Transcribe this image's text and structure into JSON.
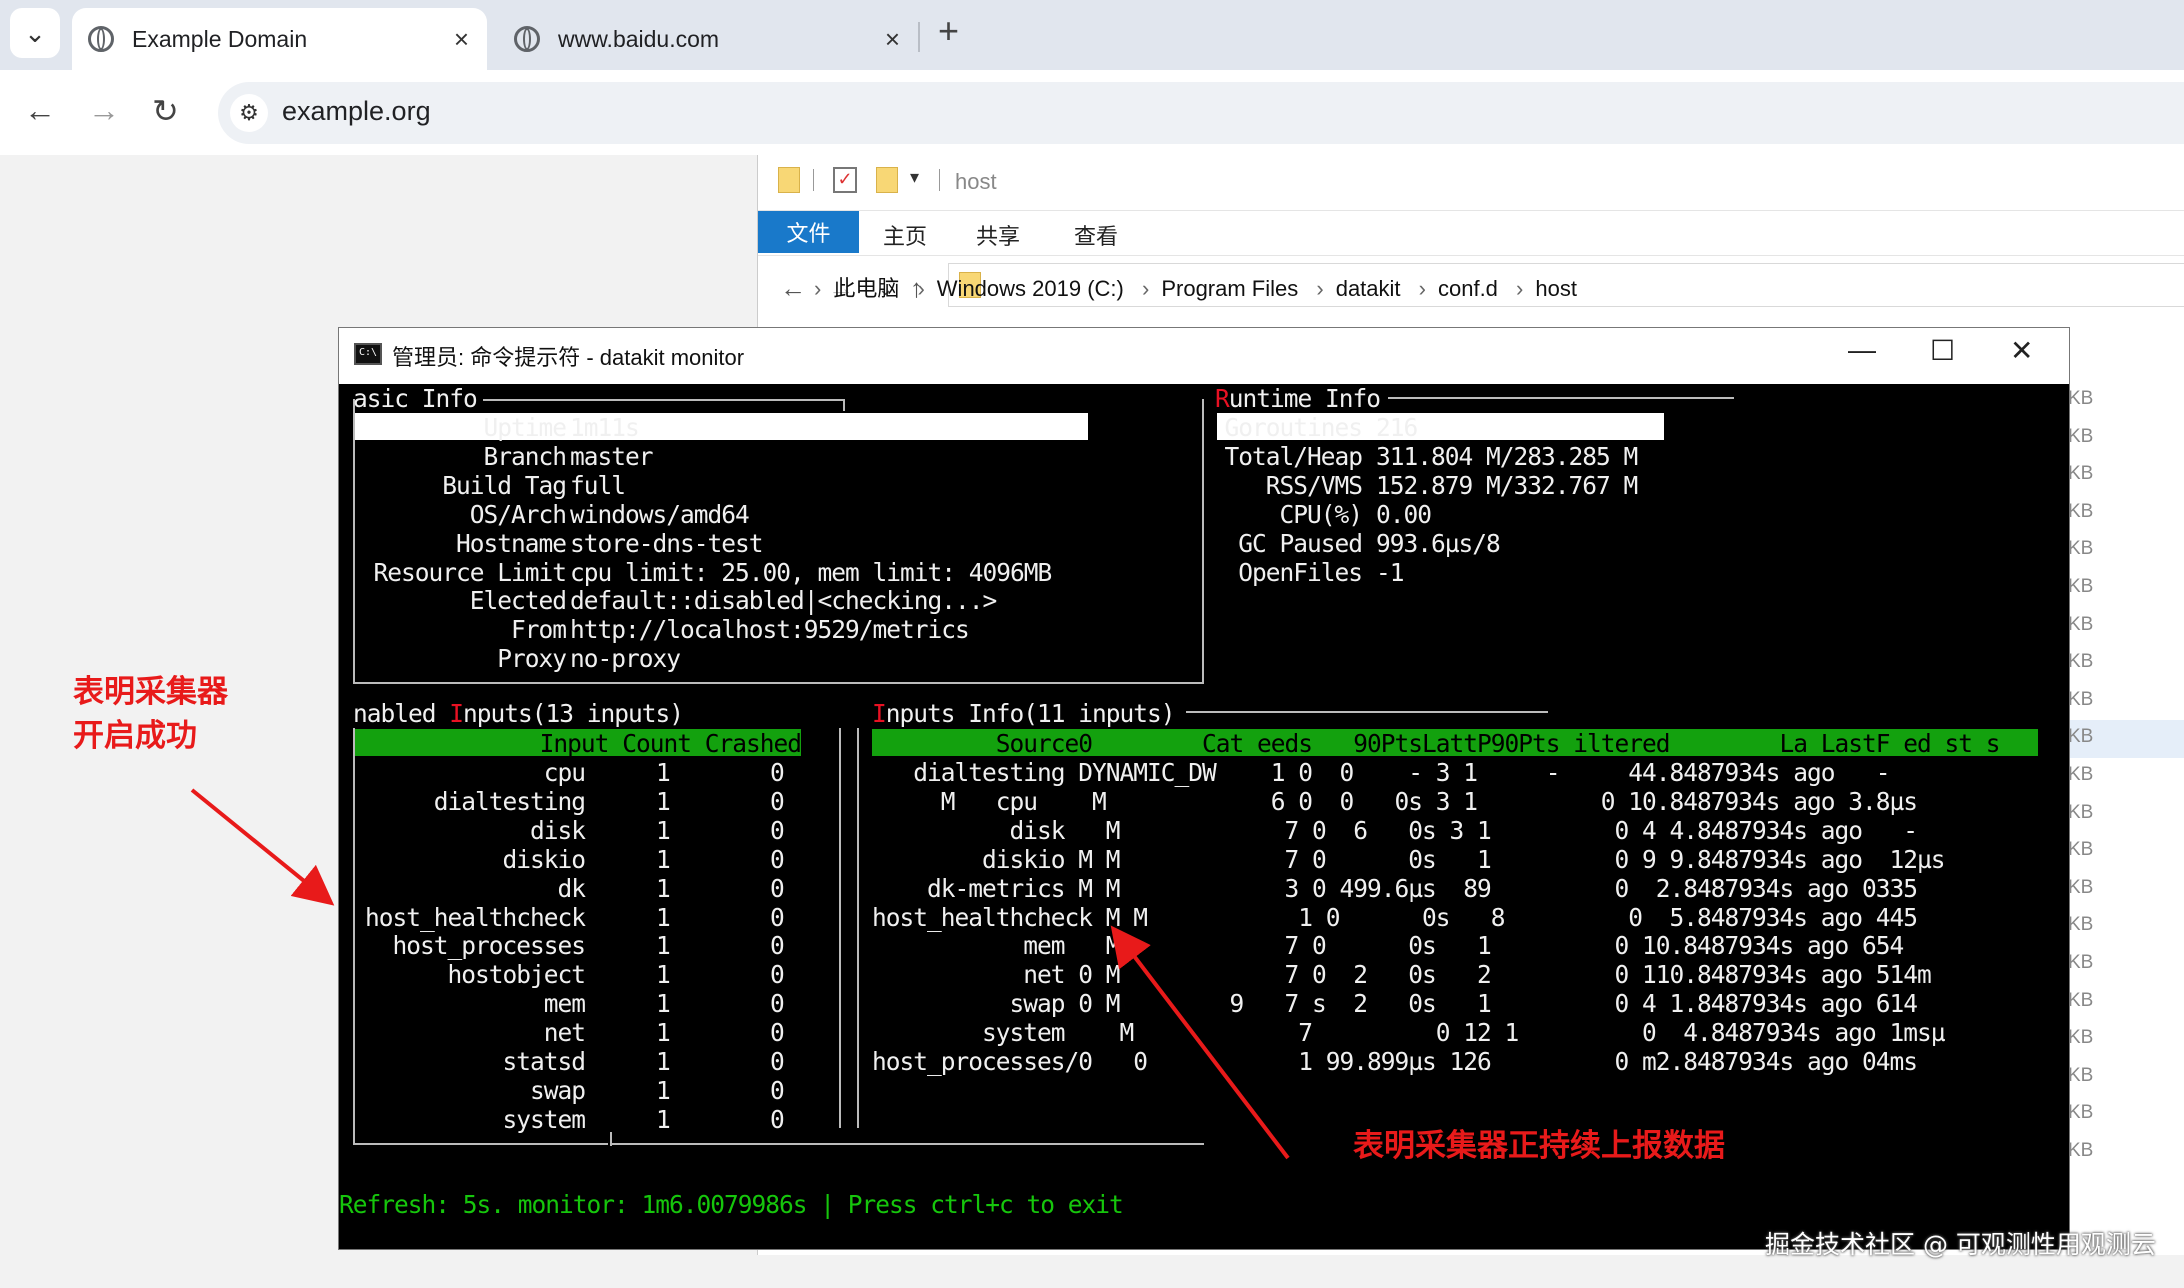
{
  "browser": {
    "tabs": [
      {
        "title": "Example Domain",
        "close": "×"
      },
      {
        "title": "www.baidu.com",
        "close": "×"
      }
    ],
    "new_tab": "+",
    "menu_icon": "⌄",
    "address": "example.org",
    "nav": {
      "back": "←",
      "forward": "→",
      "reload": "↻"
    }
  },
  "explorer": {
    "title": "host",
    "ribbon": {
      "file": "文件",
      "home": "主页",
      "share": "共享",
      "view": "查看"
    },
    "breadcrumbs": [
      "此电脑",
      "Windows 2019 (C:)",
      "Program Files",
      "datakit",
      "conf.d",
      "host"
    ],
    "size_unit": "KB"
  },
  "console": {
    "title": "管理员: 命令提示符 - datakit  monitor",
    "basic_info": {
      "header": "asic Info",
      "rows": [
        {
          "key": "Uptime",
          "value": "1m11s"
        },
        {
          "key": "Branch",
          "value": "master"
        },
        {
          "key": "Build Tag",
          "value": "full"
        },
        {
          "key": "OS/Arch",
          "value": "windows/amd64"
        },
        {
          "key": "Hostname",
          "value": "store-dns-test"
        },
        {
          "key": "Resource Limit",
          "value": "cpu limit: 25.00, mem limit: 4096MB"
        },
        {
          "key": "Elected",
          "value": "default::disabled|<checking...>"
        },
        {
          "key": "From",
          "value": "http://localhost:9529/metrics"
        },
        {
          "key": "Proxy",
          "value": "no-proxy"
        }
      ]
    },
    "runtime_info": {
      "header_first": "R",
      "header_rest": "untime Info",
      "rows": [
        {
          "key": "Goroutines",
          "value": "216"
        },
        {
          "key": "Total/Heap",
          "value": "311.804 M/283.285 M"
        },
        {
          "key": "RSS/VMS",
          "value": "152.879 M/332.767 M"
        },
        {
          "key": "CPU(%)",
          "value": "0.00"
        },
        {
          "key": "GC Paused",
          "value": "993.6µs/8"
        },
        {
          "key": "OpenFiles",
          "value": "-1"
        }
      ]
    },
    "enabled_inputs": {
      "header_prefix": "nabled ",
      "header_first": "I",
      "header_rest": "nputs(13 inputs)",
      "columns": [
        "Input",
        "Count",
        "Crashed"
      ],
      "rows": [
        [
          "cpu",
          "1",
          "0"
        ],
        [
          "dialtesting",
          "1",
          "0"
        ],
        [
          "disk",
          "1",
          "0"
        ],
        [
          "diskio",
          "1",
          "0"
        ],
        [
          "dk",
          "1",
          "0"
        ],
        [
          "host_healthcheck",
          "1",
          "0"
        ],
        [
          "host_processes",
          "1",
          "0"
        ],
        [
          "hostobject",
          "1",
          "0"
        ],
        [
          "mem",
          "1",
          "0"
        ],
        [
          "net",
          "1",
          "0"
        ],
        [
          "statsd",
          "1",
          "0"
        ],
        [
          "swap",
          "1",
          "0"
        ],
        [
          "system",
          "1",
          "0"
        ]
      ]
    },
    "inputs_info": {
      "header_first": "I",
      "header_rest": "nputs Info(11 inputs)",
      "columns": [
        "Source",
        "Cat",
        "eeds",
        "90PtsLatt",
        "P90Pts",
        "iltered",
        "La",
        "LastF",
        "ed",
        "st",
        "s"
      ],
      "header_line": "         Source0        Cat eeds   90PtsLattP90Pts iltered        La LastF ed st s",
      "rows": [
        "   dialtesting DYNAMIC_DW    1 0  0    - 3 1     -     44.8487934s ago   -",
        "     M   cpu    M            6 0  0   0s 3 1         0 10.8487934s ago 3.8µs",
        "          disk   M            7 0  6   0s 3 1         0 4 4.8487934s ago   -",
        "        diskio M M            7 0      0s   1         0 9 9.8487934s ago  12µs",
        "    dk-metrics M M            3 0 499.6µs  89         0  2.8487934s ago 0335",
        "host_healthcheck M M           1 0      0s   8         0  5.8487934s ago 445",
        "           mem   M            7 0      0s   1         0 10.8487934s ago 654",
        "           net 0 M            7 0  2   0s   2         0 110.8487934s ago 514m",
        "          swap 0 M        9   7 s  2   0s   1         0 4 1.8487934s ago 614",
        "        system    M            7         0 12 1         0  4.8487934s ago 1msµ",
        "host_processes/0   0           1 99.899µs 126         0 m2.8487934s ago 04ms"
      ]
    },
    "footer": "Refresh: 5s. monitor: 1m6.0079986s | Press ctrl+c to exit"
  },
  "annotations": {
    "left": "表明采集器\n开启成功",
    "right": "表明采集器正持续上报数据",
    "color": "#e81a1a"
  },
  "watermark": "掘金技术社区 @ 可观测性用观测云"
}
